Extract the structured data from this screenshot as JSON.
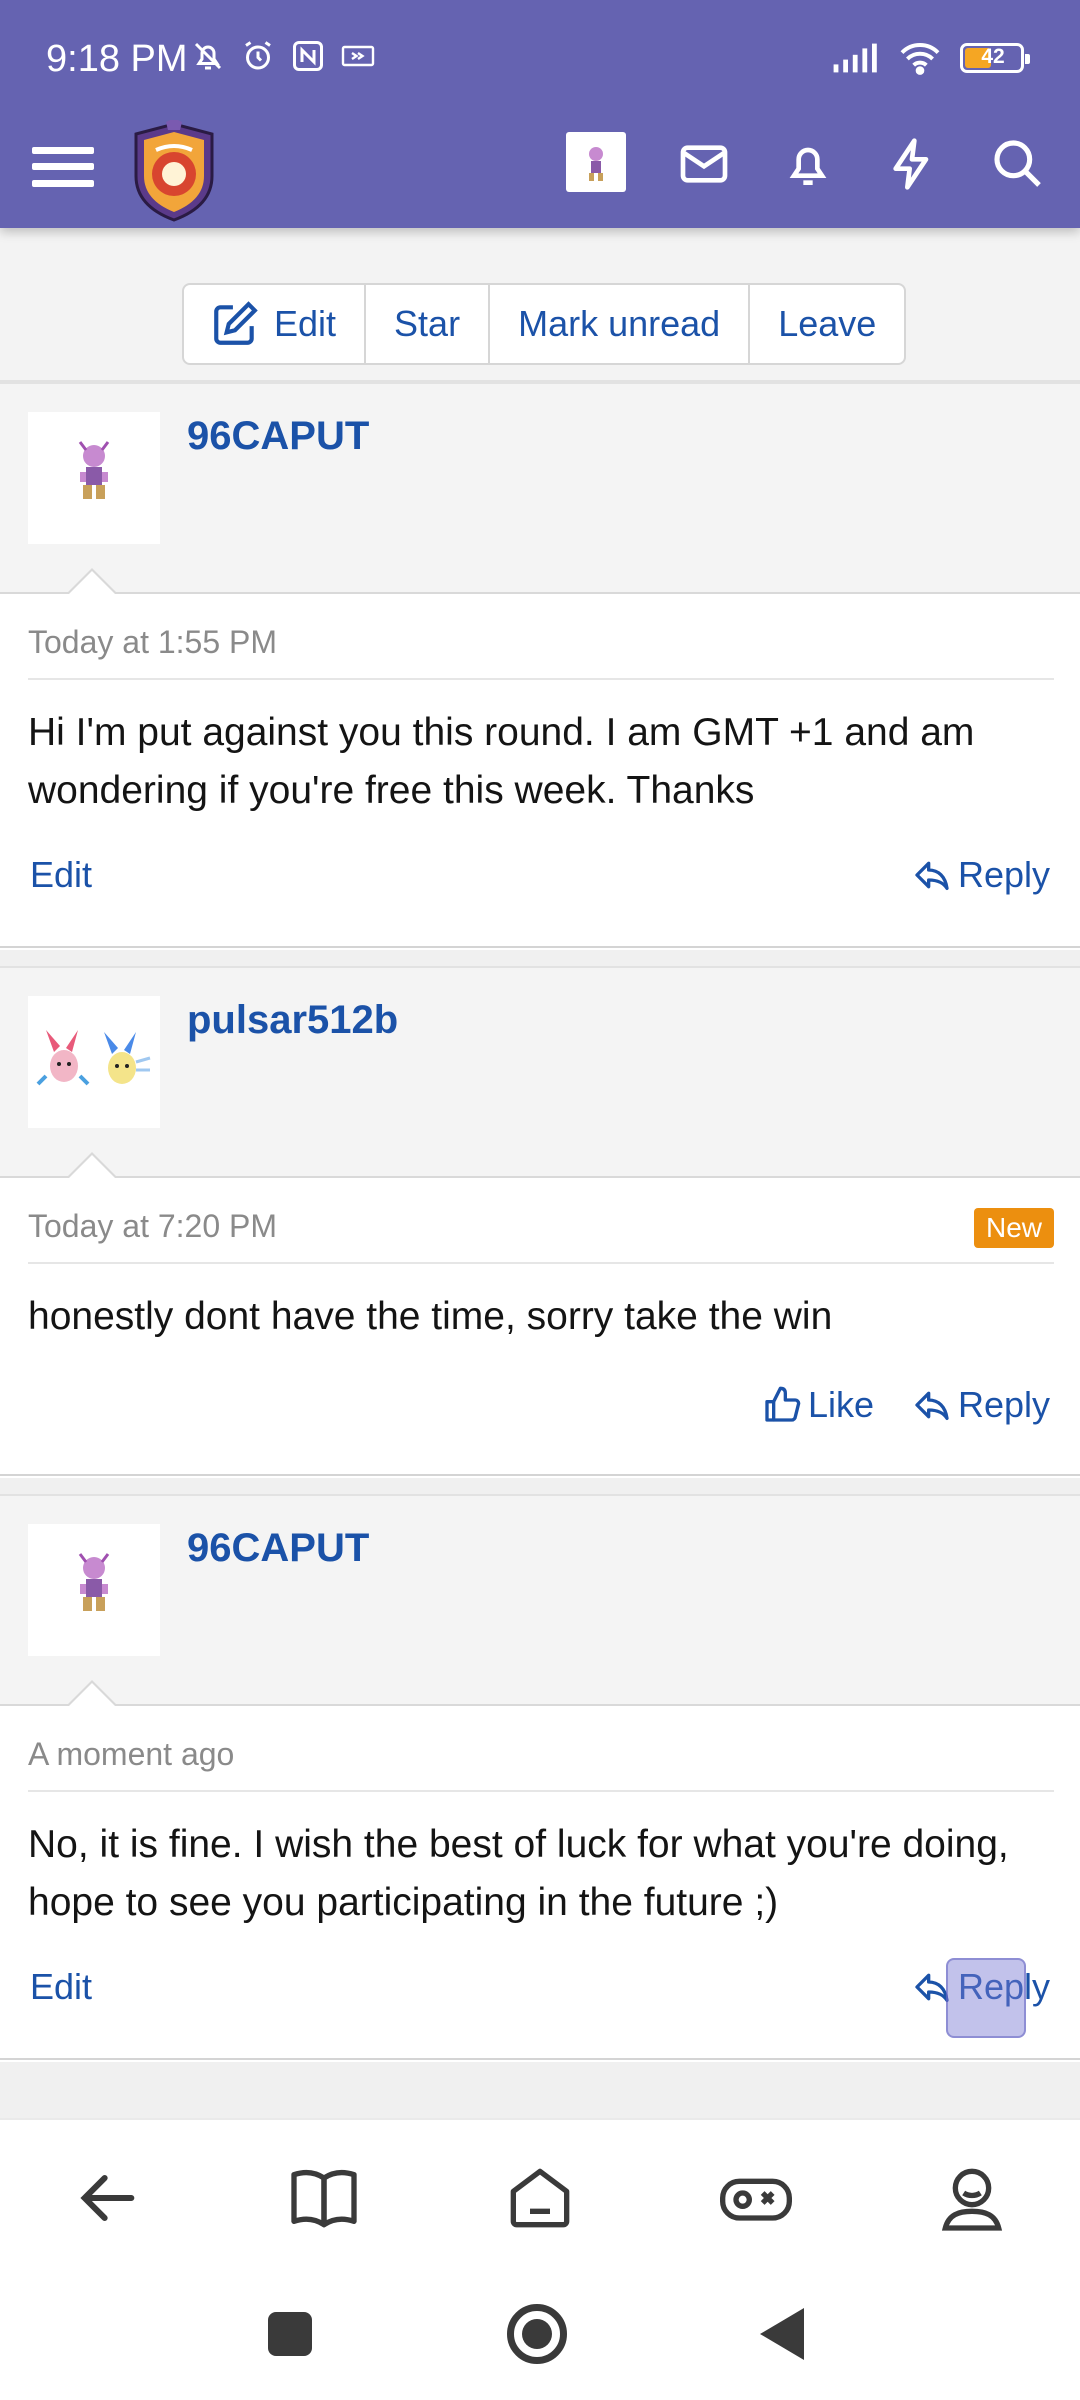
{
  "status_bar": {
    "time": "9:18 PM",
    "battery_percent": "42",
    "icons": [
      "mute-bell-icon",
      "alarm-icon",
      "nfc-icon",
      "cast-icon",
      "signal-icon",
      "wifi-icon",
      "battery-icon"
    ]
  },
  "header": {
    "icons": [
      "menu-icon",
      "site-logo",
      "user-avatar",
      "mail-icon",
      "bell-icon",
      "lightning-icon",
      "search-icon"
    ],
    "bg_color": "#6563b1"
  },
  "conversation_actions": {
    "edit": "Edit",
    "star": "Star",
    "mark_unread": "Mark unread",
    "leave": "Leave"
  },
  "messages": [
    {
      "username": "96CAPUT",
      "timestamp": "Today at 1:55 PM",
      "text": "Hi I'm put against you this round. I am GMT +1 and am wondering if you're free this week. Thanks",
      "edit_label": "Edit",
      "reply_label": "Reply"
    },
    {
      "username": "pulsar512b",
      "timestamp": "Today at 7:20 PM",
      "badge": "New",
      "text": "honestly dont have the time, sorry take the win",
      "like_label": "Like",
      "reply_label": "Reply"
    },
    {
      "username": "96CAPUT",
      "timestamp": "A moment ago",
      "text": "No, it is fine. I wish the best of luck for what you're doing, hope to see you participating in the future ;)",
      "edit_label": "Edit",
      "reply_label": "Reply"
    }
  ],
  "bottom_nav": [
    "back-arrow-icon",
    "book-icon",
    "home-icon",
    "gamepad-icon",
    "profile-icon"
  ],
  "colors": {
    "link": "#1b52a8",
    "accent_new": "#ec8f0f"
  }
}
